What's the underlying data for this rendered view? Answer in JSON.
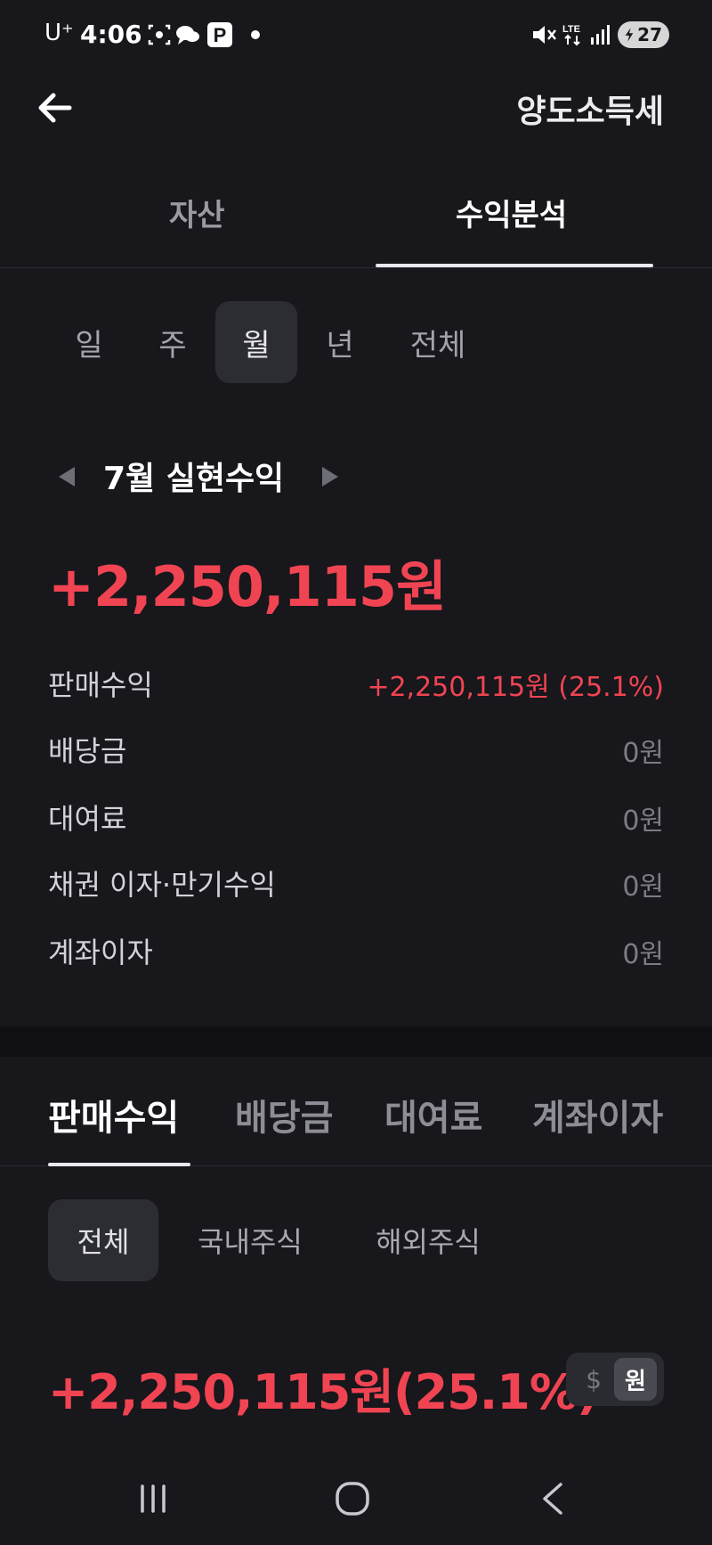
{
  "status_bar": {
    "carrier": "U⁺",
    "time": "4:06",
    "battery": "27",
    "icons": [
      "screenshot-icon",
      "chat-icon",
      "parking-icon",
      "notification-dot",
      "mute-icon",
      "lte-icon",
      "signal-icon",
      "battery-icon"
    ]
  },
  "header": {
    "back_icon": "arrow-left-icon",
    "action_label": "양도소득세"
  },
  "main_tabs": [
    {
      "label": "자산",
      "active": false
    },
    {
      "label": "수익분석",
      "active": true
    }
  ],
  "period_filters": [
    {
      "label": "일",
      "active": false
    },
    {
      "label": "주",
      "active": false
    },
    {
      "label": "월",
      "active": true
    },
    {
      "label": "년",
      "active": false
    },
    {
      "label": "전체",
      "active": false
    }
  ],
  "summary": {
    "prev_icon": "triangle-left-icon",
    "next_icon": "triangle-right-icon",
    "title": "7월 실현수익",
    "total": "+2,250,115원"
  },
  "breakdown": [
    {
      "label": "판매수익",
      "value": "+2,250,115원 (25.1%)"
    },
    {
      "label": "배당금",
      "value": "0원"
    },
    {
      "label": "대여료",
      "value": "0원"
    },
    {
      "label": "채권 이자·만기수익",
      "value": "0원"
    },
    {
      "label": "계좌이자",
      "value": "0원"
    }
  ],
  "sub_tabs": [
    {
      "label": "판매수익",
      "active": true
    },
    {
      "label": "배당금",
      "active": false
    },
    {
      "label": "대여료",
      "active": false
    },
    {
      "label": "계좌이자",
      "active": false
    }
  ],
  "market_filters": [
    {
      "label": "전체",
      "active": true
    },
    {
      "label": "국내주식",
      "active": false
    },
    {
      "label": "해외주식",
      "active": false
    }
  ],
  "sales_profit": {
    "amount": "+2,250,115원(25.1%)",
    "currency_usd": "$",
    "currency_krw": "원",
    "selected_currency": "원"
  },
  "nav_bar": {
    "icons": [
      "recent-apps-icon",
      "home-icon",
      "back-icon"
    ]
  },
  "colors": {
    "background": "#17171c",
    "profit_red": "#f04452",
    "chip_active": "#2c2c33"
  }
}
